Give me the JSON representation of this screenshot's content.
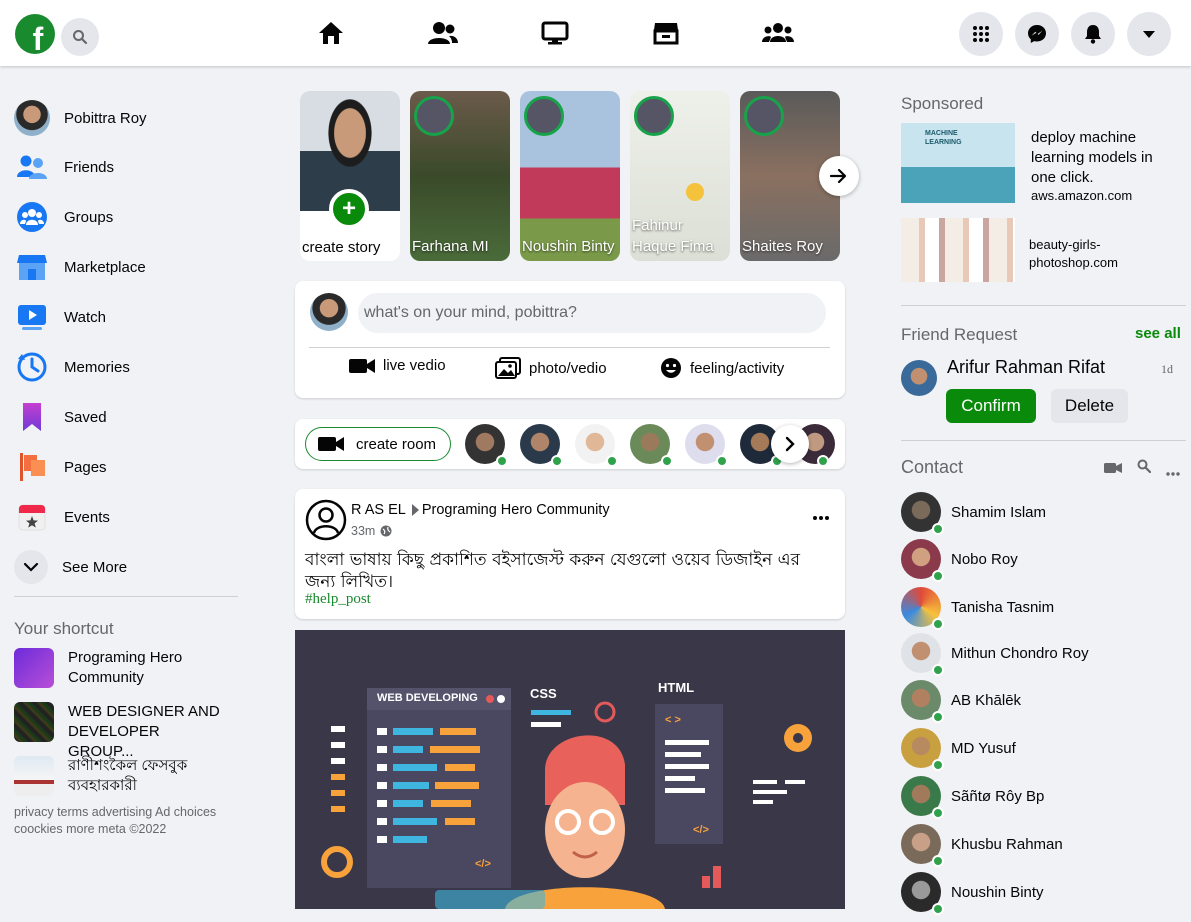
{
  "header": {
    "logo_letter": "f",
    "nav": [
      "home-icon",
      "friends-icon",
      "watch-icon",
      "marketplace-icon",
      "groups-icon"
    ],
    "right_buttons": [
      "menu-grid-icon",
      "messenger-icon",
      "notifications-icon",
      "account-dropdown-icon"
    ]
  },
  "sidebar": {
    "profile_name": "Pobittra Roy",
    "items": [
      {
        "label": "Friends",
        "icon": "friends-icon"
      },
      {
        "label": "Groups",
        "icon": "groups-icon"
      },
      {
        "label": "Marketplace",
        "icon": "marketplace-icon"
      },
      {
        "label": "Watch",
        "icon": "watch-icon"
      },
      {
        "label": "Memories",
        "icon": "memories-icon"
      },
      {
        "label": "Saved",
        "icon": "saved-icon"
      },
      {
        "label": "Pages",
        "icon": "pages-icon"
      },
      {
        "label": "Events",
        "icon": "events-icon"
      }
    ],
    "see_more": "See More",
    "shortcut_title": "Your shortcut",
    "shortcuts": [
      {
        "label": "Programing Hero Community"
      },
      {
        "label": "WEB DESIGNER AND DEVELOPER GROUP..."
      },
      {
        "label": "রাণীশংকৈল ফেসবুক ব্যবহারকারী"
      }
    ],
    "footer_line1": "privacy terms advertising Ad choices",
    "footer_line2": "coockies more meta ©2022"
  },
  "stories": {
    "create_label": "create story",
    "items": [
      {
        "name": "Farhana MI"
      },
      {
        "name": "Noushin Binty"
      },
      {
        "name": "Fahinur Haque Fima"
      },
      {
        "name": "Shaites Roy"
      }
    ]
  },
  "composer": {
    "placeholder": "what's on your mind, pobittra?",
    "live": "live vedio",
    "photo": "photo/vedio",
    "feeling": "feeling/activity"
  },
  "rooms": {
    "create_label": "create room"
  },
  "post": {
    "author": "R AS EL",
    "group": "Programing Hero Community",
    "time": "33m",
    "text": "বাংলা ভাষায় কিছু প্রকাশিত বইসাজেস্ট করুন যেগুলো ওয়েব ডিজাইন এর জন্য লিখিত।",
    "hashtag": "#help_post",
    "image": {
      "web_label": "WEB DEVELOPING",
      "css_label": "CSS",
      "html_label": "HTML",
      "code_tag": "</>",
      "code_tag_open": "< >"
    }
  },
  "right": {
    "sponsored_title": "Sponsored",
    "image_caption": "MACHINE LEARNING",
    "ads": [
      {
        "text": "deploy machine learning models in one click.",
        "domain": "aws.amazon.com"
      },
      {
        "text": "",
        "domain": "beauty-girls-photoshop.com"
      }
    ],
    "friend_request_title": "Friend Request",
    "see_all": "see all",
    "request_name": "Arifur Rahman Rifat",
    "request_time": "1d",
    "confirm": "Confirm",
    "delete": "Delete",
    "contact_title": "Contact",
    "contacts": [
      {
        "name": "Shamim Islam"
      },
      {
        "name": "Nobo Roy"
      },
      {
        "name": "Tanisha Tasnim"
      },
      {
        "name": "Mithun Chondro Roy"
      },
      {
        "name": "AB Khālēk"
      },
      {
        "name": "MD Yusuf"
      },
      {
        "name": "Sãñtø Rôy Bp"
      },
      {
        "name": "Khusbu Rahman"
      },
      {
        "name": "Noushin Binty"
      }
    ]
  },
  "colors": {
    "accent": "#1a8a2f",
    "online": "#31a24c",
    "background": "#f0f2f5"
  }
}
